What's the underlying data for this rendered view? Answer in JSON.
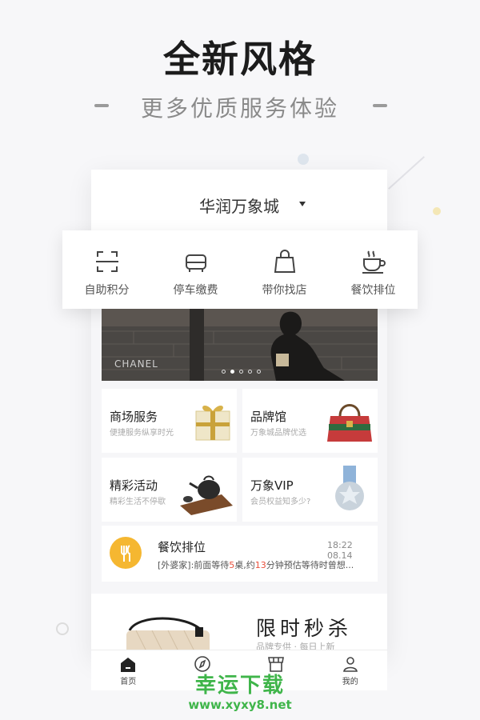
{
  "promo": {
    "headline": "全新风格",
    "subline": "更多优质服务体验"
  },
  "app": {
    "mall_name": "华润万象城",
    "quick_actions": [
      {
        "label": "自助积分",
        "icon": "scan-icon"
      },
      {
        "label": "停车缴费",
        "icon": "car-icon"
      },
      {
        "label": "带你找店",
        "icon": "shopping-bag-icon"
      },
      {
        "label": "餐饮排位",
        "icon": "coffee-cup-icon"
      }
    ],
    "banner": {
      "brand_text": "CHANEL",
      "slide_count": 5,
      "active_slide": 2
    },
    "tiles": [
      {
        "title": "商场服务",
        "subtitle": "便捷服务纵享时光",
        "icon": "gift-box-icon"
      },
      {
        "title": "品牌馆",
        "subtitle": "万象城品牌优选",
        "icon": "handbag-icon"
      },
      {
        "title": "精彩活动",
        "subtitle": "精彩生活不停歇",
        "icon": "teapot-icon"
      },
      {
        "title": "万象VIP",
        "subtitle": "会员权益知多少?",
        "icon": "medal-icon"
      }
    ],
    "queue": {
      "title": "餐饮排位",
      "time": "18:22 08.14",
      "desc_prefix": "[外婆家]:前面等待",
      "tables_waiting": "5",
      "desc_mid1": "桌,约",
      "minutes": "13",
      "desc_suffix": "分钟预估等待时曾想..."
    },
    "flash_sale": {
      "title": "限时秒杀",
      "subtitle": "品牌专供 · 每日上新"
    },
    "tabs": [
      {
        "label": "首页",
        "icon": "home-icon",
        "active": true
      },
      {
        "label": "",
        "icon": "compass-icon",
        "active": false
      },
      {
        "label": "",
        "icon": "store-icon",
        "active": false
      },
      {
        "label": "我的",
        "icon": "user-icon",
        "active": false
      }
    ]
  },
  "watermark": {
    "text": "幸运下载",
    "url": "www.xyxy8.net"
  },
  "colors": {
    "accent_green": "#3fb54a",
    "highlight_red": "#e9503c",
    "queue_yellow": "#f5b731"
  }
}
